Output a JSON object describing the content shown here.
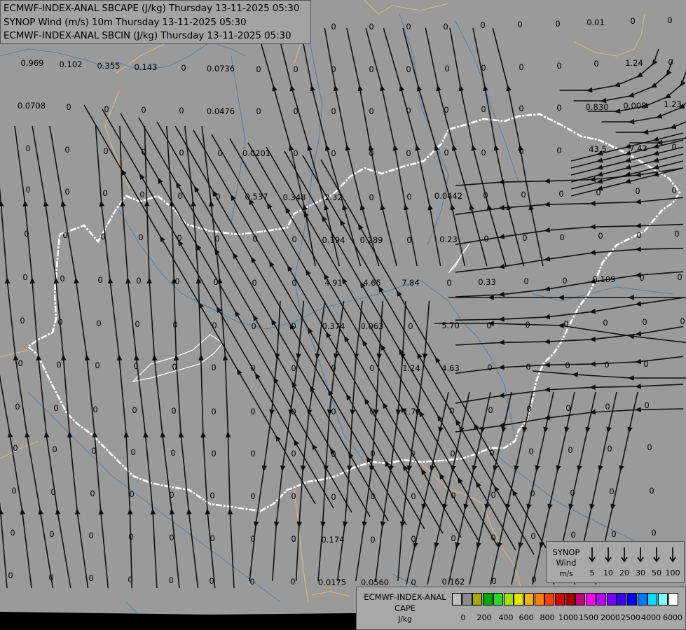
{
  "titles": [
    "ECMWF-INDEX-ANAL SBCAPE (J/kg) Thursday 13-11-2025 05:30",
    "SYNOP Wind (m/s) 10m Thursday 13-11-2025 05:30",
    "ECMWF-INDEX-ANAL SBCIN (J/kg) Thursday 13-11-2025 05:30"
  ],
  "colors": {
    "background": "#9a9a9a",
    "border": "#ffffff",
    "rivers": "#4f7fa8",
    "regions": "#d8b878",
    "streamlines": "#111111"
  },
  "cape_values": [
    [
      "0.969",
      46,
      90
    ],
    [
      "0.102",
      101,
      92
    ],
    [
      "0.355",
      155,
      94
    ],
    [
      "0.143",
      208,
      96
    ],
    [
      "0",
      262,
      97
    ],
    [
      "0.0736",
      315,
      98
    ],
    [
      "0",
      369,
      99
    ],
    [
      "0",
      422,
      99
    ],
    [
      "0",
      476,
      99
    ],
    [
      "0",
      530,
      99
    ],
    [
      "0",
      583,
      99
    ],
    [
      "0",
      638,
      98
    ],
    [
      "0",
      690,
      97
    ],
    [
      "0",
      744,
      96
    ],
    [
      "0",
      798,
      94
    ],
    [
      "0",
      851,
      91
    ],
    [
      "1.24",
      905,
      90
    ],
    [
      "0",
      957,
      89
    ],
    [
      "0.0708",
      45,
      151
    ],
    [
      "0",
      98,
      153
    ],
    [
      "0",
      152,
      156
    ],
    [
      "0",
      205,
      157
    ],
    [
      "0",
      259,
      158
    ],
    [
      "0.0476",
      315,
      159
    ],
    [
      "0",
      369,
      159
    ],
    [
      "0",
      422,
      159
    ],
    [
      "0",
      476,
      159
    ],
    [
      "0",
      530,
      159
    ],
    [
      "0",
      583,
      158
    ],
    [
      "0",
      637,
      157
    ],
    [
      "0",
      690,
      156
    ],
    [
      "0",
      744,
      155
    ],
    [
      "0",
      798,
      154
    ],
    [
      "0.830",
      852,
      153
    ],
    [
      "0.008",
      906,
      151
    ],
    [
      "1.23",
      960,
      149
    ],
    [
      "0",
      40,
      212
    ],
    [
      "0",
      96,
      214
    ],
    [
      "0",
      151,
      216
    ],
    [
      "0",
      205,
      217
    ],
    [
      "0",
      259,
      218
    ],
    [
      "0",
      314,
      219
    ],
    [
      "0.0201",
      366,
      219
    ],
    [
      "0",
      422,
      219
    ],
    [
      "0",
      476,
      219
    ],
    [
      "0",
      530,
      219
    ],
    [
      "0",
      583,
      219
    ],
    [
      "0",
      637,
      218
    ],
    [
      "0",
      690,
      218
    ],
    [
      "0",
      744,
      216
    ],
    [
      "0",
      798,
      215
    ],
    [
      "43.5",
      853,
      213
    ],
    [
      "7.43",
      911,
      212
    ],
    [
      "0",
      962,
      210
    ],
    [
      "0",
      40,
      271
    ],
    [
      "0",
      96,
      274
    ],
    [
      "0",
      150,
      276
    ],
    [
      "0",
      203,
      278
    ],
    [
      "0",
      257,
      280
    ],
    [
      "0",
      311,
      281
    ],
    [
      "0.537",
      366,
      281
    ],
    [
      "0.348",
      420,
      282
    ],
    [
      "2.32",
      476,
      282
    ],
    [
      "0",
      530,
      282
    ],
    [
      "0",
      584,
      281
    ],
    [
      "0.0442",
      640,
      280
    ],
    [
      "0",
      693,
      279
    ],
    [
      "0",
      747,
      278
    ],
    [
      "0",
      801,
      277
    ],
    [
      "0",
      854,
      275
    ],
    [
      "0",
      910,
      273
    ],
    [
      "0",
      962,
      272
    ],
    [
      "0",
      38,
      334
    ],
    [
      "0",
      93,
      336
    ],
    [
      "0",
      147,
      338
    ],
    [
      "0",
      201,
      339
    ],
    [
      "0",
      256,
      340
    ],
    [
      "0",
      310,
      341
    ],
    [
      "0",
      364,
      341
    ],
    [
      "0",
      420,
      342
    ],
    [
      "0.194",
      476,
      343
    ],
    [
      "0.289",
      530,
      343
    ],
    [
      "0",
      584,
      343
    ],
    [
      "0.23",
      640,
      342
    ],
    [
      "0",
      694,
      341
    ],
    [
      "0",
      749,
      340
    ],
    [
      "0",
      802,
      339
    ],
    [
      "0",
      857,
      337
    ],
    [
      "0",
      912,
      336
    ],
    [
      "0",
      966,
      334
    ],
    [
      "0",
      36,
      396
    ],
    [
      "0",
      89,
      398
    ],
    [
      "0",
      143,
      400
    ],
    [
      "0",
      198,
      401
    ],
    [
      "0",
      253,
      402
    ],
    [
      "0",
      308,
      403
    ],
    [
      "0",
      363,
      404
    ],
    [
      "0",
      420,
      404
    ],
    [
      "4.91",
      476,
      404
    ],
    [
      "4.65",
      531,
      404
    ],
    [
      "7.84",
      586,
      404
    ],
    [
      "0",
      641,
      404
    ],
    [
      "0.33",
      695,
      403
    ],
    [
      "0",
      751,
      402
    ],
    [
      "0",
      806,
      401
    ],
    [
      "0.109",
      862,
      399
    ],
    [
      "0",
      916,
      397
    ],
    [
      "0",
      970,
      396
    ],
    [
      "0",
      32,
      458
    ],
    [
      "0",
      86,
      460
    ],
    [
      "0",
      141,
      462
    ],
    [
      "0",
      196,
      463
    ],
    [
      "0",
      250,
      464
    ],
    [
      "0",
      306,
      465
    ],
    [
      "0",
      362,
      466
    ],
    [
      "0",
      419,
      466
    ],
    [
      "0.374",
      476,
      466
    ],
    [
      "0.063",
      531,
      466
    ],
    [
      "0",
      586,
      466
    ],
    [
      "5.70",
      643,
      465
    ],
    [
      "0",
      698,
      465
    ],
    [
      "0",
      753,
      464
    ],
    [
      "0",
      808,
      463
    ],
    [
      "0",
      864,
      461
    ],
    [
      "0",
      920,
      460
    ],
    [
      "0",
      974,
      459
    ],
    [
      "0",
      29,
      519
    ],
    [
      "0",
      84,
      521
    ],
    [
      "0",
      139,
      522
    ],
    [
      "0",
      194,
      523
    ],
    [
      "0",
      249,
      524
    ],
    [
      "0",
      305,
      525
    ],
    [
      "0",
      361,
      526
    ],
    [
      "0",
      419,
      526
    ],
    [
      "0",
      476,
      526
    ],
    [
      "0",
      531,
      526
    ],
    [
      "1.24",
      587,
      526
    ],
    [
      "4.63",
      643,
      526
    ],
    [
      "0",
      699,
      525
    ],
    [
      "0",
      754,
      524
    ],
    [
      "0",
      810,
      522
    ],
    [
      "0",
      866,
      521
    ],
    [
      "0",
      922,
      520
    ],
    [
      "0",
      25,
      581
    ],
    [
      "0",
      80,
      583
    ],
    [
      "0",
      136,
      585
    ],
    [
      "0",
      192,
      586
    ],
    [
      "0",
      248,
      587
    ],
    [
      "0",
      305,
      588
    ],
    [
      "0",
      361,
      588
    ],
    [
      "0",
      419,
      588
    ],
    [
      "0",
      476,
      588
    ],
    [
      "0",
      531,
      588
    ],
    [
      "1.73",
      588,
      588
    ],
    [
      "0",
      645,
      587
    ],
    [
      "0",
      700,
      586
    ],
    [
      "0",
      755,
      584
    ],
    [
      "0",
      811,
      583
    ],
    [
      "0",
      867,
      581
    ],
    [
      "0",
      923,
      579
    ],
    [
      "0",
      22,
      640
    ],
    [
      "0",
      78,
      642
    ],
    [
      "0",
      134,
      644
    ],
    [
      "0",
      190,
      646
    ],
    [
      "0",
      247,
      647
    ],
    [
      "0",
      305,
      648
    ],
    [
      "0",
      361,
      648
    ],
    [
      "0",
      419,
      648
    ],
    [
      "0",
      476,
      649
    ],
    [
      "0",
      532,
      648
    ],
    [
      "0",
      589,
      648
    ],
    [
      "0",
      646,
      648
    ],
    [
      "0",
      702,
      647
    ],
    [
      "0",
      758,
      645
    ],
    [
      "0",
      814,
      643
    ],
    [
      "0",
      870,
      641
    ],
    [
      "0",
      927,
      639
    ],
    [
      "0",
      20,
      701
    ],
    [
      "0",
      76,
      703
    ],
    [
      "0",
      132,
      705
    ],
    [
      "0",
      188,
      706
    ],
    [
      "0",
      245,
      707
    ],
    [
      "0",
      303,
      708
    ],
    [
      "0",
      361,
      709
    ],
    [
      "0",
      419,
      709
    ],
    [
      "0",
      476,
      710
    ],
    [
      "0",
      532,
      709
    ],
    [
      "0",
      590,
      709
    ],
    [
      "0",
      647,
      708
    ],
    [
      "0",
      704,
      707
    ],
    [
      "0",
      760,
      705
    ],
    [
      "0",
      817,
      704
    ],
    [
      "0",
      873,
      702
    ],
    [
      "0",
      930,
      701
    ],
    [
      "0",
      18,
      761
    ],
    [
      "0",
      74,
      763
    ],
    [
      "0",
      130,
      765
    ],
    [
      "0",
      187,
      767
    ],
    [
      "0",
      245,
      768
    ],
    [
      "0",
      303,
      769
    ],
    [
      "0",
      361,
      770
    ],
    [
      "0",
      419,
      770
    ],
    [
      "0.174",
      475,
      771
    ],
    [
      "0",
      532,
      771
    ],
    [
      "0",
      590,
      770
    ],
    [
      "0",
      647,
      769
    ],
    [
      "0",
      704,
      768
    ],
    [
      "0",
      761,
      766
    ],
    [
      "0",
      818,
      764
    ],
    [
      "0",
      876,
      763
    ],
    [
      "0",
      933,
      761
    ],
    [
      "0",
      15,
      822
    ],
    [
      "0",
      73,
      825
    ],
    [
      "0",
      130,
      826
    ],
    [
      "0",
      186,
      828
    ],
    [
      "0",
      244,
      829
    ],
    [
      "0",
      302,
      830
    ],
    [
      "0",
      360,
      831
    ],
    [
      "0",
      418,
      831
    ],
    [
      "0.0175",
      474,
      832
    ],
    [
      "0.0560",
      535,
      832
    ],
    [
      "0",
      590,
      832
    ],
    [
      "0.162",
      647,
      831
    ],
    [
      "0",
      705,
      830
    ],
    [
      "0",
      762,
      828
    ],
    [
      "0",
      819,
      826
    ],
    [
      "0",
      876,
      824
    ],
    [
      "0",
      934,
      822
    ],
    [
      "0",
      422,
      38
    ],
    [
      "0",
      476,
      38
    ],
    [
      "0",
      530,
      38
    ],
    [
      "0",
      583,
      38
    ],
    [
      "0",
      636,
      38
    ],
    [
      "0",
      689,
      36
    ],
    [
      "0",
      742,
      35
    ],
    [
      "0",
      796,
      34
    ],
    [
      "0.01",
      850,
      32
    ],
    [
      "0",
      903,
      30
    ],
    [
      "0",
      956,
      29
    ]
  ],
  "wind_legend": {
    "title_line1": "SYNOP",
    "title_line2": "Wind",
    "unit": "m/s",
    "speeds": [
      "5",
      "10",
      "20",
      "30",
      "50",
      "100"
    ]
  },
  "cape_legend": {
    "title_line1": "ECMWF-INDEX-ANAL",
    "title_line2": "CAPE",
    "unit": "J/kg",
    "ticks": [
      "0",
      "200",
      "400",
      "600",
      "800",
      "1000",
      "1500",
      "2000",
      "2500",
      "4000",
      "6000"
    ],
    "swatches": [
      "#bdbdbd",
      "#8c8c8c",
      "#a8a800",
      "#00a800",
      "#28d828",
      "#a8e000",
      "#e6e600",
      "#f0b400",
      "#ff7f00",
      "#ff4000",
      "#d80000",
      "#a80000",
      "#c80078",
      "#ff00ff",
      "#c000ff",
      "#7800ff",
      "#3c00ff",
      "#0000ff",
      "#0078ff",
      "#00dcff",
      "#7cffff",
      "#ffffff"
    ]
  }
}
